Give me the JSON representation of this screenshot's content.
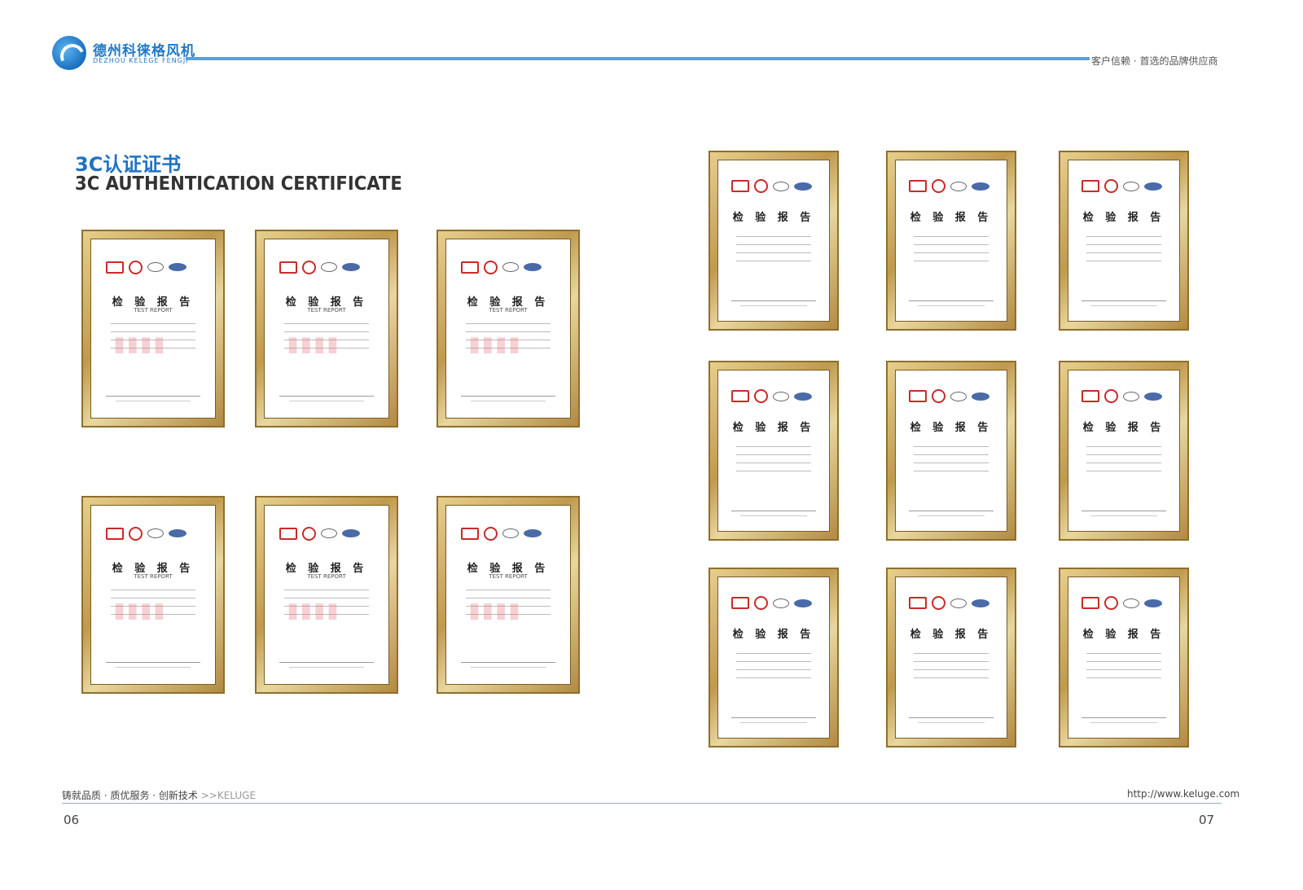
{
  "header": {
    "brand_cn": "德州科徕格风机",
    "brand_en": "DEZHOU KELEGE FENGJI",
    "slogan": "客户信赖 · 首选的品牌供应商"
  },
  "title": {
    "cn": "3C认证证书",
    "en": "3C AUTHENTICATION CERTIFICATE"
  },
  "certificates_left": [
    {
      "heading": "检 验 报 告",
      "sub": "TEST REPORT"
    },
    {
      "heading": "检 验 报 告",
      "sub": "TEST REPORT"
    },
    {
      "heading": "检 验 报 告",
      "sub": "TEST REPORT"
    },
    {
      "heading": "检 验 报 告",
      "sub": "TEST REPORT"
    },
    {
      "heading": "检 验 报 告",
      "sub": "TEST REPORT"
    },
    {
      "heading": "检 验 报 告",
      "sub": "TEST REPORT"
    }
  ],
  "certificates_right": [
    {
      "heading": "检 验 报 告"
    },
    {
      "heading": "检 验 报 告"
    },
    {
      "heading": "检 验 报 告"
    },
    {
      "heading": "检 验 报 告"
    },
    {
      "heading": "检 验 报 告"
    },
    {
      "heading": "检 验 报 告"
    },
    {
      "heading": "检 验 报 告"
    },
    {
      "heading": "检 验 报 告"
    },
    {
      "heading": "检 验 报 告"
    }
  ],
  "footer": {
    "tagline": "铸就品质 · 质优服务 · 创新技术",
    "tagline_accent": ">>KELUGE",
    "url": "http://www.keluge.com",
    "page_left": "06",
    "page_right": "07"
  }
}
